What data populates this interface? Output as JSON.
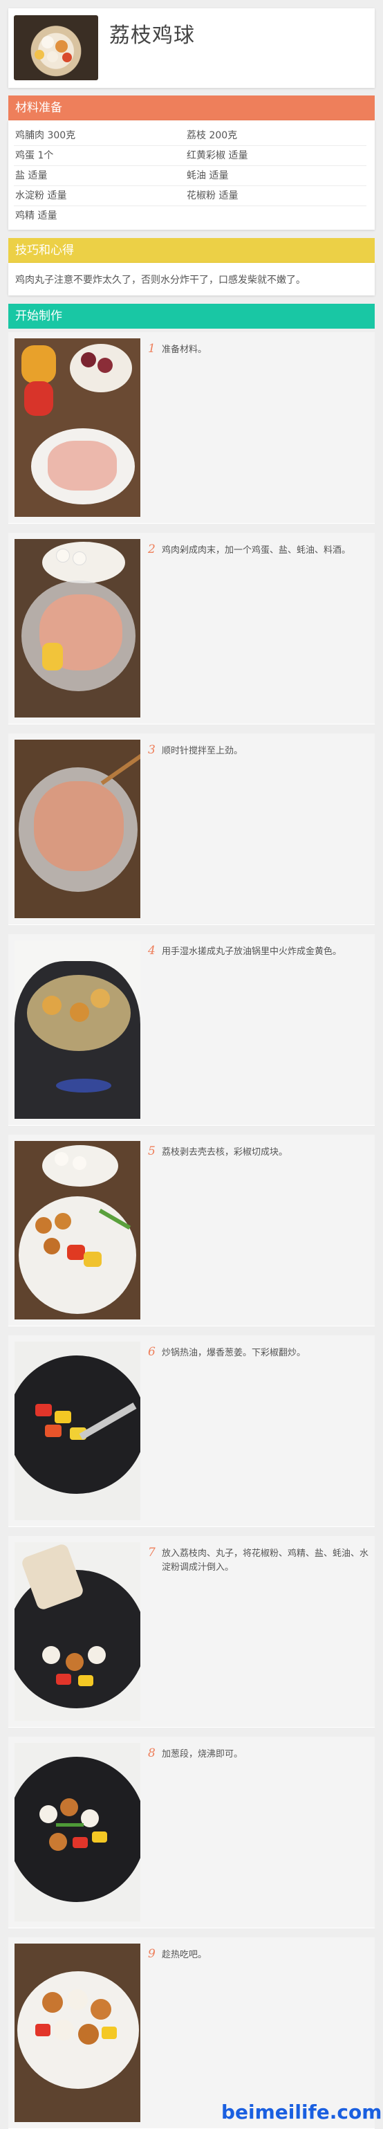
{
  "recipe": {
    "title": "荔枝鸡球"
  },
  "ingredients": {
    "header": "材料准备",
    "items": [
      "鸡脯肉 300克",
      "荔枝 200克",
      "鸡蛋 1个",
      "红黄彩椒 适量",
      "盐 适量",
      "蚝油 适量",
      "水淀粉 适量",
      "花椒粉 适量",
      "鸡精 适量"
    ]
  },
  "tips": {
    "header": "技巧和心得",
    "text": "鸡肉丸子注意不要炸太久了，否则水分炸干了，口感发柴就不嫩了。"
  },
  "steps": {
    "header": "开始制作",
    "items": [
      {
        "num": "1",
        "text": "准备材料。"
      },
      {
        "num": "2",
        "text": "鸡肉剁成肉末，加一个鸡蛋、盐、蚝油、料酒。"
      },
      {
        "num": "3",
        "text": "顺时针搅拌至上劲。"
      },
      {
        "num": "4",
        "text": "用手湿水搓成丸子放油锅里中火炸成金黄色。"
      },
      {
        "num": "5",
        "text": "荔枝剥去壳去核，彩椒切成块。"
      },
      {
        "num": "6",
        "text": "炒锅热油，爆香葱姜。下彩椒翻炒。"
      },
      {
        "num": "7",
        "text": "放入荔枝肉、丸子，将花椒粉、鸡精、盐、蚝油、水淀粉调成汁倒入。"
      },
      {
        "num": "8",
        "text": "加葱段，烧沸即可。"
      },
      {
        "num": "9",
        "text": "趁热吃吧。"
      }
    ]
  },
  "watermark": "beimeilife.com",
  "colors": {
    "ingredients_bar": "#ee7f5b",
    "tips_bar": "#ecd046",
    "steps_bar": "#19c7a4",
    "step_number": "#ee7f5b",
    "watermark": "#1a5fe0"
  }
}
